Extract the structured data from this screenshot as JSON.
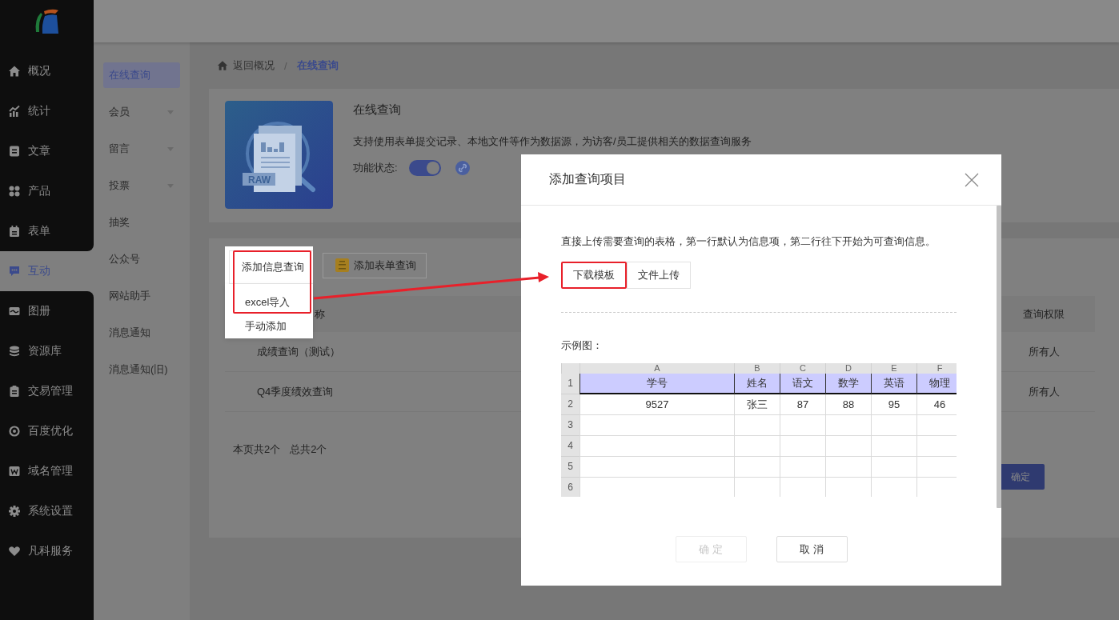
{
  "sidebar": {
    "items": [
      {
        "label": "概况",
        "kind": "home",
        "selected": false
      },
      {
        "label": "统计",
        "kind": "chart",
        "selected": false
      },
      {
        "label": "文章",
        "kind": "doc",
        "selected": false
      },
      {
        "label": "产品",
        "kind": "grid",
        "selected": false
      },
      {
        "label": "表单",
        "kind": "form",
        "selected": false
      },
      {
        "label": "互动",
        "kind": "chat",
        "selected": true
      },
      {
        "label": "图册",
        "kind": "image",
        "selected": false
      },
      {
        "label": "资源库",
        "kind": "database",
        "selected": false
      },
      {
        "label": "交易管理",
        "kind": "clipboard",
        "selected": false
      },
      {
        "label": "百度优化",
        "kind": "target",
        "selected": false
      },
      {
        "label": "域名管理",
        "kind": "wbox",
        "selected": false
      },
      {
        "label": "系统设置",
        "kind": "gear",
        "selected": false
      },
      {
        "label": "凡科服务",
        "kind": "heart",
        "selected": false
      }
    ]
  },
  "subnav": {
    "items": [
      {
        "label": "在线查询",
        "selected": true,
        "expandable": false
      },
      {
        "label": "会员",
        "selected": false,
        "expandable": true
      },
      {
        "label": "留言",
        "selected": false,
        "expandable": true
      },
      {
        "label": "投票",
        "selected": false,
        "expandable": true
      },
      {
        "label": "抽奖",
        "selected": false,
        "expandable": false
      },
      {
        "label": "公众号",
        "selected": false,
        "expandable": false
      },
      {
        "label": "网站助手",
        "selected": false,
        "expandable": false
      },
      {
        "label": "消息通知",
        "selected": false,
        "expandable": false
      },
      {
        "label": "消息通知(旧)",
        "selected": false,
        "expandable": false
      }
    ]
  },
  "breadcrumb": {
    "back": "返回概况",
    "separator": "/",
    "current": "在线查询"
  },
  "feature": {
    "title": "在线查询",
    "description": "支持使用表单提交记录、本地文件等作为数据源，为访客/员工提供相关的数据查询服务",
    "illustration_tag": "RAW",
    "status_label": "功能状态:",
    "status_on": true
  },
  "queries": {
    "add_info_button": "添加信息查询",
    "add_form_button": "添加表单查询",
    "menu": [
      {
        "label": "excel导入",
        "highlighted": true
      },
      {
        "label": "手动添加",
        "highlighted": false
      }
    ],
    "columns": [
      "称",
      "查询权限"
    ],
    "rows": [
      {
        "name": "成绩查询（测试）",
        "permission": "所有人"
      },
      {
        "name": "Q4季度绩效查询",
        "permission": "所有人"
      }
    ],
    "summary": [
      "本页共2个",
      "总共2个"
    ],
    "confirm_button": "确定"
  },
  "dialog": {
    "title": "添加查询项目",
    "instruction": "直接上传需要查询的表格，第一行默认为信息项，第二行往下开始为可查询信息。",
    "buttons": [
      {
        "label": "下载模板",
        "highlighted": true
      },
      {
        "label": "文件上传",
        "highlighted": false
      }
    ],
    "example_label": "示例图：",
    "sheet": {
      "column_letters": [
        "A",
        "B",
        "C",
        "D",
        "E",
        "F"
      ],
      "row_numbers": [
        "1",
        "2",
        "3",
        "4",
        "5",
        "6"
      ],
      "rows": [
        [
          "学号",
          "姓名",
          "语文",
          "数学",
          "英语",
          "物理"
        ],
        [
          "9527",
          "张三",
          "87",
          "88",
          "95",
          "46"
        ]
      ]
    },
    "footer_buttons": [
      {
        "label": "确 定",
        "disabled": true
      },
      {
        "label": "取 消",
        "disabled": false
      }
    ]
  }
}
